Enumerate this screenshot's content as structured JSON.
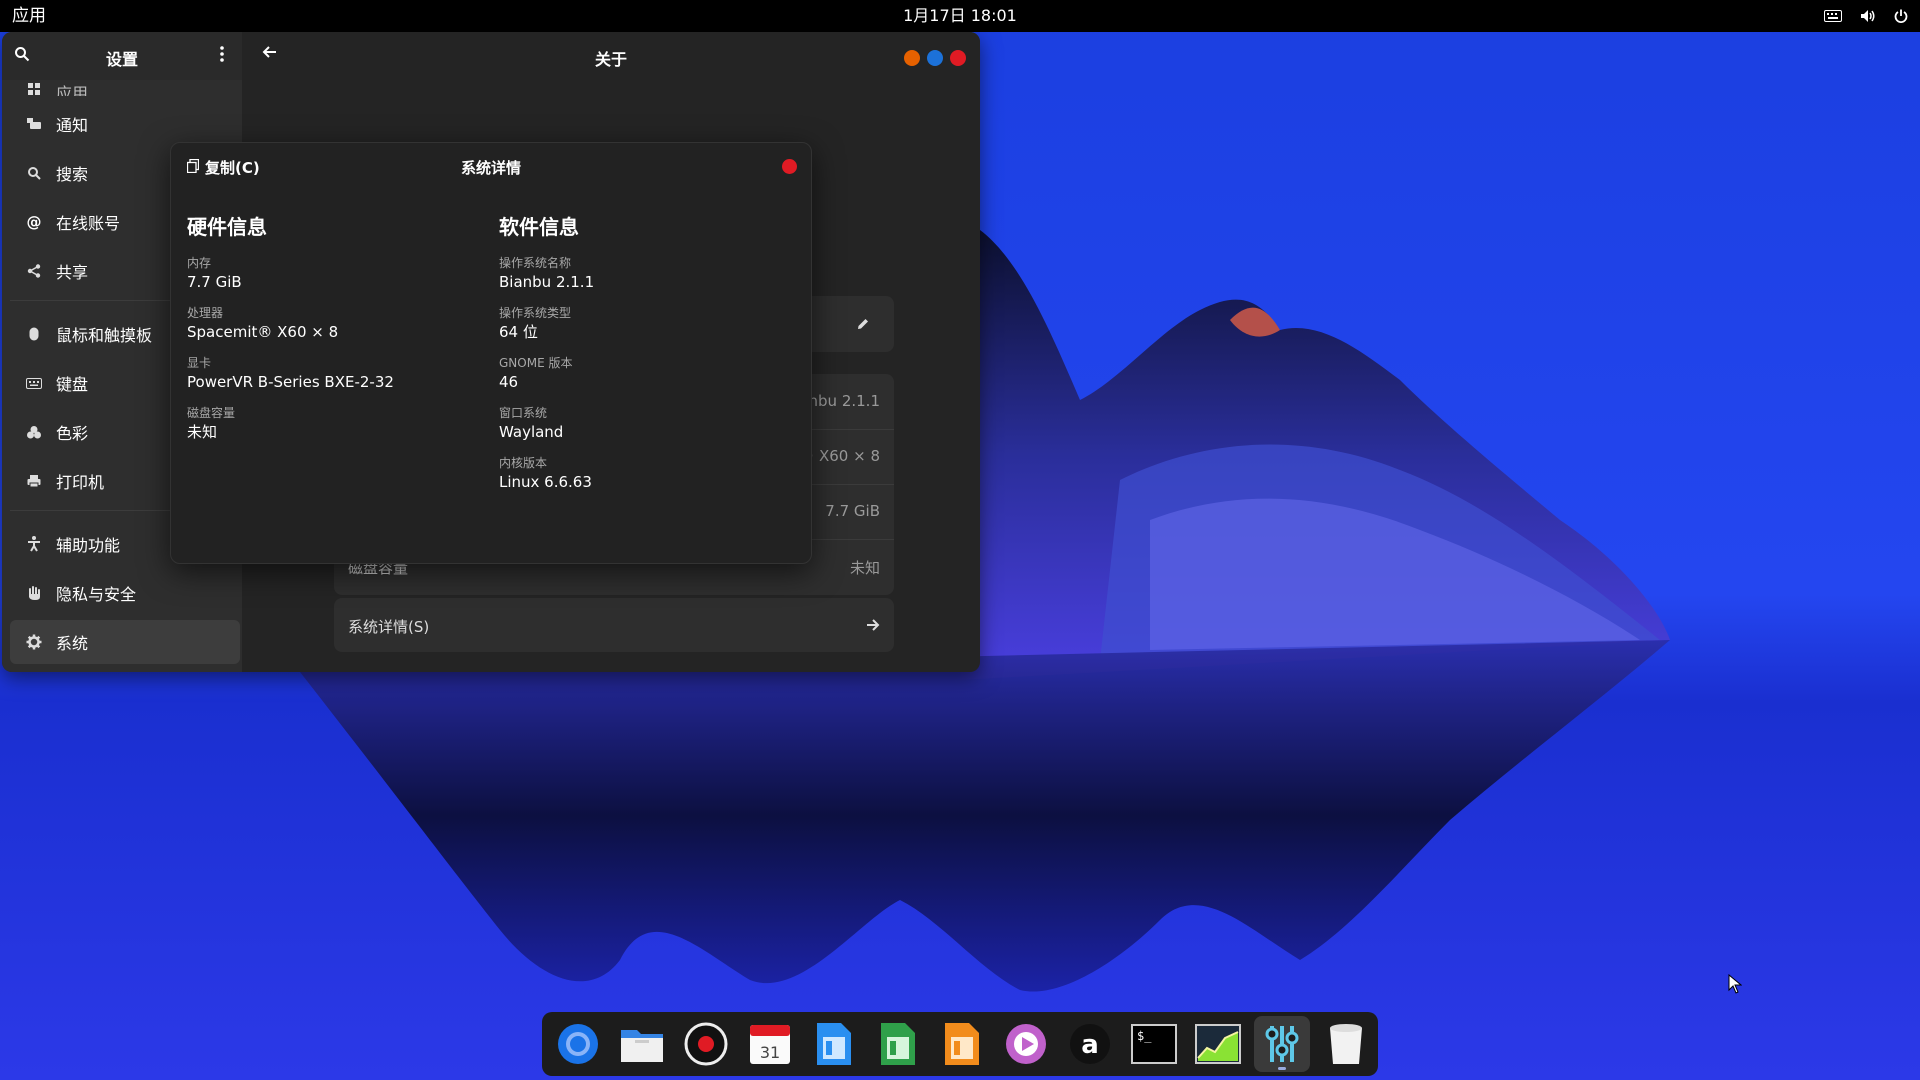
{
  "topbar": {
    "apps_label": "应用",
    "clock": "1月17日  18:01",
    "tray": [
      "keyboard-icon",
      "volume-icon",
      "power-icon"
    ]
  },
  "settings": {
    "sidebar_title": "设置",
    "items": [
      {
        "label": "应用",
        "icon": "apps-icon"
      },
      {
        "label": "通知",
        "icon": "notifications-icon"
      },
      {
        "label": "搜索",
        "icon": "search-icon"
      },
      {
        "label": "在线账号",
        "icon": "at-icon"
      },
      {
        "label": "共享",
        "icon": "share-icon"
      },
      {
        "label": "鼠标和触摸板",
        "icon": "mouse-icon"
      },
      {
        "label": "键盘",
        "icon": "keyboard-icon"
      },
      {
        "label": "色彩",
        "icon": "color-icon"
      },
      {
        "label": "打印机",
        "icon": "printer-icon"
      },
      {
        "label": "辅助功能",
        "icon": "accessibility-icon"
      },
      {
        "label": "隐私与安全",
        "icon": "hand-icon"
      },
      {
        "label": "系统",
        "icon": "gear-icon"
      }
    ],
    "content_title": "关于",
    "about_rows": [
      {
        "label": "",
        "value": "ianbu 2.1.1"
      },
      {
        "label": "",
        "value": "t® X60 × 8"
      },
      {
        "label": "",
        "value": "7.7 GiB"
      },
      {
        "label": "磁盘容量",
        "value": "未知"
      }
    ],
    "system_details_label": "系统详情(S)"
  },
  "dialog": {
    "copy_label": "复制(C)",
    "title": "系统详情",
    "hardware": {
      "heading": "硬件信息",
      "fields": [
        {
          "key": "内存",
          "value": "7.7 GiB"
        },
        {
          "key": "处理器",
          "value": "Spacemit® X60 × 8"
        },
        {
          "key": "显卡",
          "value": "PowerVR B-Series BXE-2-32"
        },
        {
          "key": "磁盘容量",
          "value": "未知"
        }
      ]
    },
    "software": {
      "heading": "软件信息",
      "fields": [
        {
          "key": "操作系统名称",
          "value": "Bianbu 2.1.1"
        },
        {
          "key": "操作系统类型",
          "value": "64 位"
        },
        {
          "key": "GNOME 版本",
          "value": "46"
        },
        {
          "key": "窗口系统",
          "value": "Wayland"
        },
        {
          "key": "内核版本",
          "value": "Linux 6.6.63"
        }
      ]
    }
  },
  "dock": {
    "calendar_day": "31",
    "apps": [
      "chromium-icon",
      "files-icon",
      "recorder-icon",
      "calendar-icon",
      "writer-icon",
      "calc-icon",
      "impress-icon",
      "media-player-icon",
      "appstore-icon",
      "terminal-icon",
      "system-monitor-icon",
      "settings-icon",
      "trash-icon"
    ]
  },
  "colors": {
    "win_orange": "#e66100",
    "win_blue": "#1c71d8",
    "win_red": "#e01b24"
  }
}
